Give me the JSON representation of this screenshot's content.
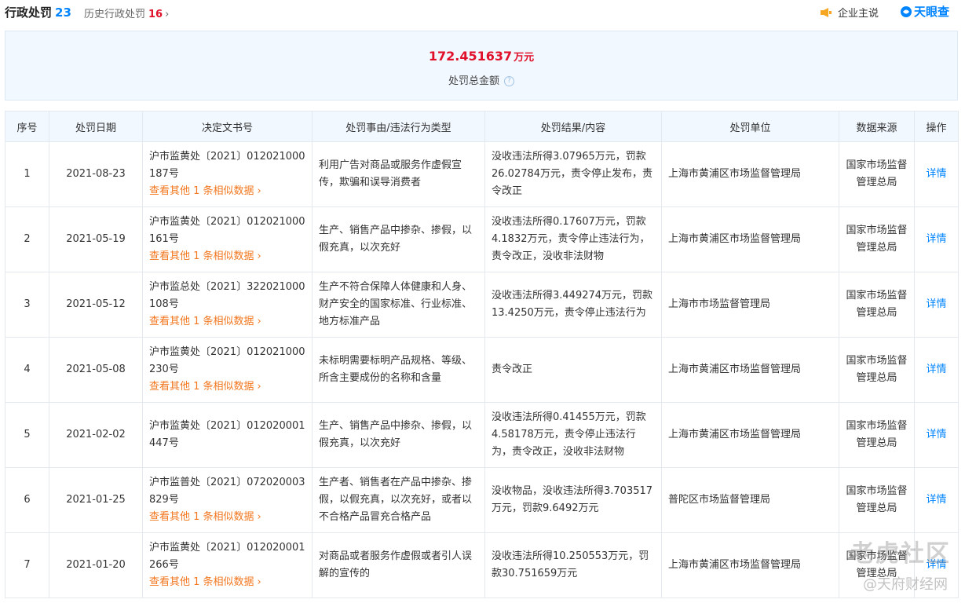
{
  "tabs": {
    "active_label": "行政处罚",
    "active_count": "23",
    "history_label": "历史行政处罚",
    "history_count": "16"
  },
  "header": {
    "claim_label": "企业主说",
    "brand_name": "天眼查"
  },
  "summary": {
    "amount": "172.451637",
    "unit": "万元",
    "label": "处罚总金额"
  },
  "table": {
    "headers": [
      "序号",
      "处罚日期",
      "决定文书号",
      "处罚事由/违法行为类型",
      "处罚结果/内容",
      "处罚单位",
      "数据来源",
      "操作"
    ],
    "rows": [
      {
        "no": "1",
        "date": "2021-08-23",
        "doc": "沪市监黄处〔2021〕012021000187号",
        "similar": "查看其他 1 条相似数据",
        "reason": "利用广告对商品或服务作虚假宣传，欺骗和误导消费者",
        "result": "没收违法所得3.07965万元，罚款26.02784万元，责令停止发布，责令改正",
        "unit": "上海市黄浦区市场监督管理局",
        "source": "国家市场监督管理总局",
        "action": "详情"
      },
      {
        "no": "2",
        "date": "2021-05-19",
        "doc": "沪市监黄处〔2021〕012021000161号",
        "similar": "查看其他 1 条相似数据",
        "reason": "生产、销售产品中掺杂、掺假，以假充真，以次充好",
        "result": "没收违法所得0.17607万元，罚款4.1832万元，责令停止违法行为，责令改正，没收非法财物",
        "unit": "上海市黄浦区市场监督管理局",
        "source": "国家市场监督管理总局",
        "action": "详情"
      },
      {
        "no": "3",
        "date": "2021-05-12",
        "doc": "沪市监总处〔2021〕322021000108号",
        "similar": "查看其他 1 条相似数据",
        "reason": "生产不符合保障人体健康和人身、财产安全的国家标准、行业标准、地方标准产品",
        "result": "没收违法所得3.449274万元，罚款13.4250万元，责令停止违法行为",
        "unit": "上海市市场监督管理局",
        "source": "国家市场监督管理总局",
        "action": "详情"
      },
      {
        "no": "4",
        "date": "2021-05-08",
        "doc": "沪市监黄处〔2021〕012021000230号",
        "similar": "查看其他 1 条相似数据",
        "reason": "未标明需要标明产品规格、等级、所含主要成份的名称和含量",
        "result": "责令改正",
        "unit": "上海市黄浦区市场监督管理局",
        "source": "国家市场监督管理总局",
        "action": "详情"
      },
      {
        "no": "5",
        "date": "2021-02-02",
        "doc": "沪市监黄处〔2021〕012020001447号",
        "similar": "",
        "reason": "生产、销售产品中掺杂、掺假，以假充真，以次充好",
        "result": "没收违法所得0.41455万元，罚款4.58178万元，责令停止违法行为，责令改正，没收非法财物",
        "unit": "上海市黄浦区市场监督管理局",
        "source": "国家市场监督管理总局",
        "action": "详情"
      },
      {
        "no": "6",
        "date": "2021-01-25",
        "doc": "沪市监普处〔2021〕072020003829号",
        "similar": "查看其他 1 条相似数据",
        "reason": "生产者、销售者在产品中掺杂、掺假，以假充真，以次充好，或者以不合格产品冒充合格产品",
        "result": "没收物品，没收违法所得3.703517万元，罚款9.6492万元",
        "unit": "普陀区市场监督管理局",
        "source": "国家市场监督管理总局",
        "action": "详情"
      },
      {
        "no": "7",
        "date": "2021-01-20",
        "doc": "沪市监黄处〔2021〕012020001266号",
        "similar": "查看其他 1 条相似数据",
        "reason": "对商品或者服务作虚假或者引人误解的宣传的",
        "result": "没收违法所得10.250553万元，罚款30.751659万元",
        "unit": "上海市黄浦区市场监督管理局",
        "source": "国家市场监督管理总局",
        "action": "详情"
      }
    ]
  },
  "watermark": {
    "line1": "老虎社区",
    "line2": "@天府财经网"
  }
}
